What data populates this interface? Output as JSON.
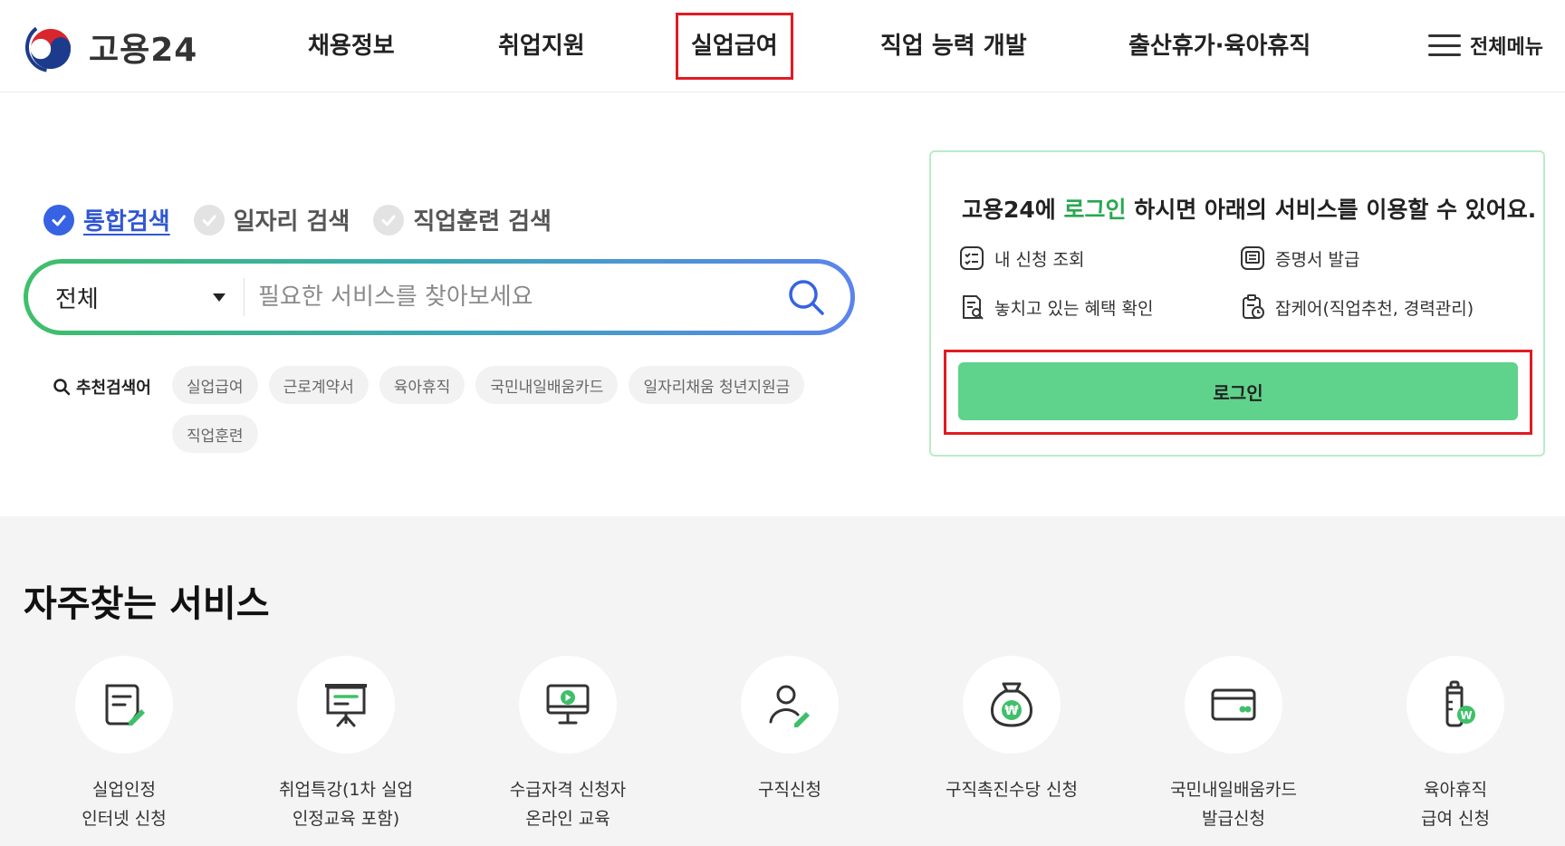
{
  "header": {
    "logo_text": "고용24",
    "nav": [
      {
        "label": "채용정보"
      },
      {
        "label": "취업지원"
      },
      {
        "label": "실업급여"
      },
      {
        "label": "직업 능력 개발"
      },
      {
        "label": "출산휴가·육아휴직"
      }
    ],
    "all_menu_label": "전체메뉴"
  },
  "search": {
    "tabs": [
      {
        "label": "통합검색",
        "active": true
      },
      {
        "label": "일자리 검색",
        "active": false
      },
      {
        "label": "직업훈련 검색",
        "active": false
      }
    ],
    "select_value": "전체",
    "placeholder": "필요한 서비스를 찾아보세요",
    "recommended_label": "추천검색어",
    "recommended": [
      "실업급여",
      "근로계약서",
      "육아휴직",
      "국민내일배움카드",
      "일자리채움 청년지원금",
      "직업훈련"
    ]
  },
  "login_panel": {
    "title_pre": "고용24에 ",
    "title_highlight": "로그인",
    "title_post": " 하시면 아래의 서비스를 이용할 수 있어요.",
    "services": [
      {
        "label": "내 신청 조회",
        "icon": "list-icon"
      },
      {
        "label": "증명서 발급",
        "icon": "certificate-icon"
      },
      {
        "label": "놓치고 있는 혜택 확인",
        "icon": "document-search-icon"
      },
      {
        "label": "잡케어(직업추천, 경력관리)",
        "icon": "clipboard-clock-icon"
      }
    ],
    "login_button": "로그인"
  },
  "frequent": {
    "title": "자주찾는 서비스",
    "items": [
      {
        "line1": "실업인정",
        "line2": "인터넷 신청",
        "icon": "document-edit-icon"
      },
      {
        "line1": "취업특강(1차 실업",
        "line2": "인정교육 포함)",
        "icon": "presentation-icon"
      },
      {
        "line1": "수급자격 신청자",
        "line2": "온라인 교육",
        "icon": "monitor-play-icon"
      },
      {
        "line1": "구직신청",
        "line2": "",
        "icon": "person-edit-icon"
      },
      {
        "line1": "구직촉진수당 신청",
        "line2": "",
        "icon": "money-bag-icon"
      },
      {
        "line1": "국민내일배움카드",
        "line2": "발급신청",
        "icon": "card-icon"
      },
      {
        "line1": "육아휴직",
        "line2": "급여 신청",
        "icon": "baby-bottle-icon"
      }
    ]
  },
  "colors": {
    "accent_blue": "#3662e3",
    "accent_green": "#27a84f",
    "login_button": "#5fd28b",
    "highlight_red": "#e01b24"
  }
}
